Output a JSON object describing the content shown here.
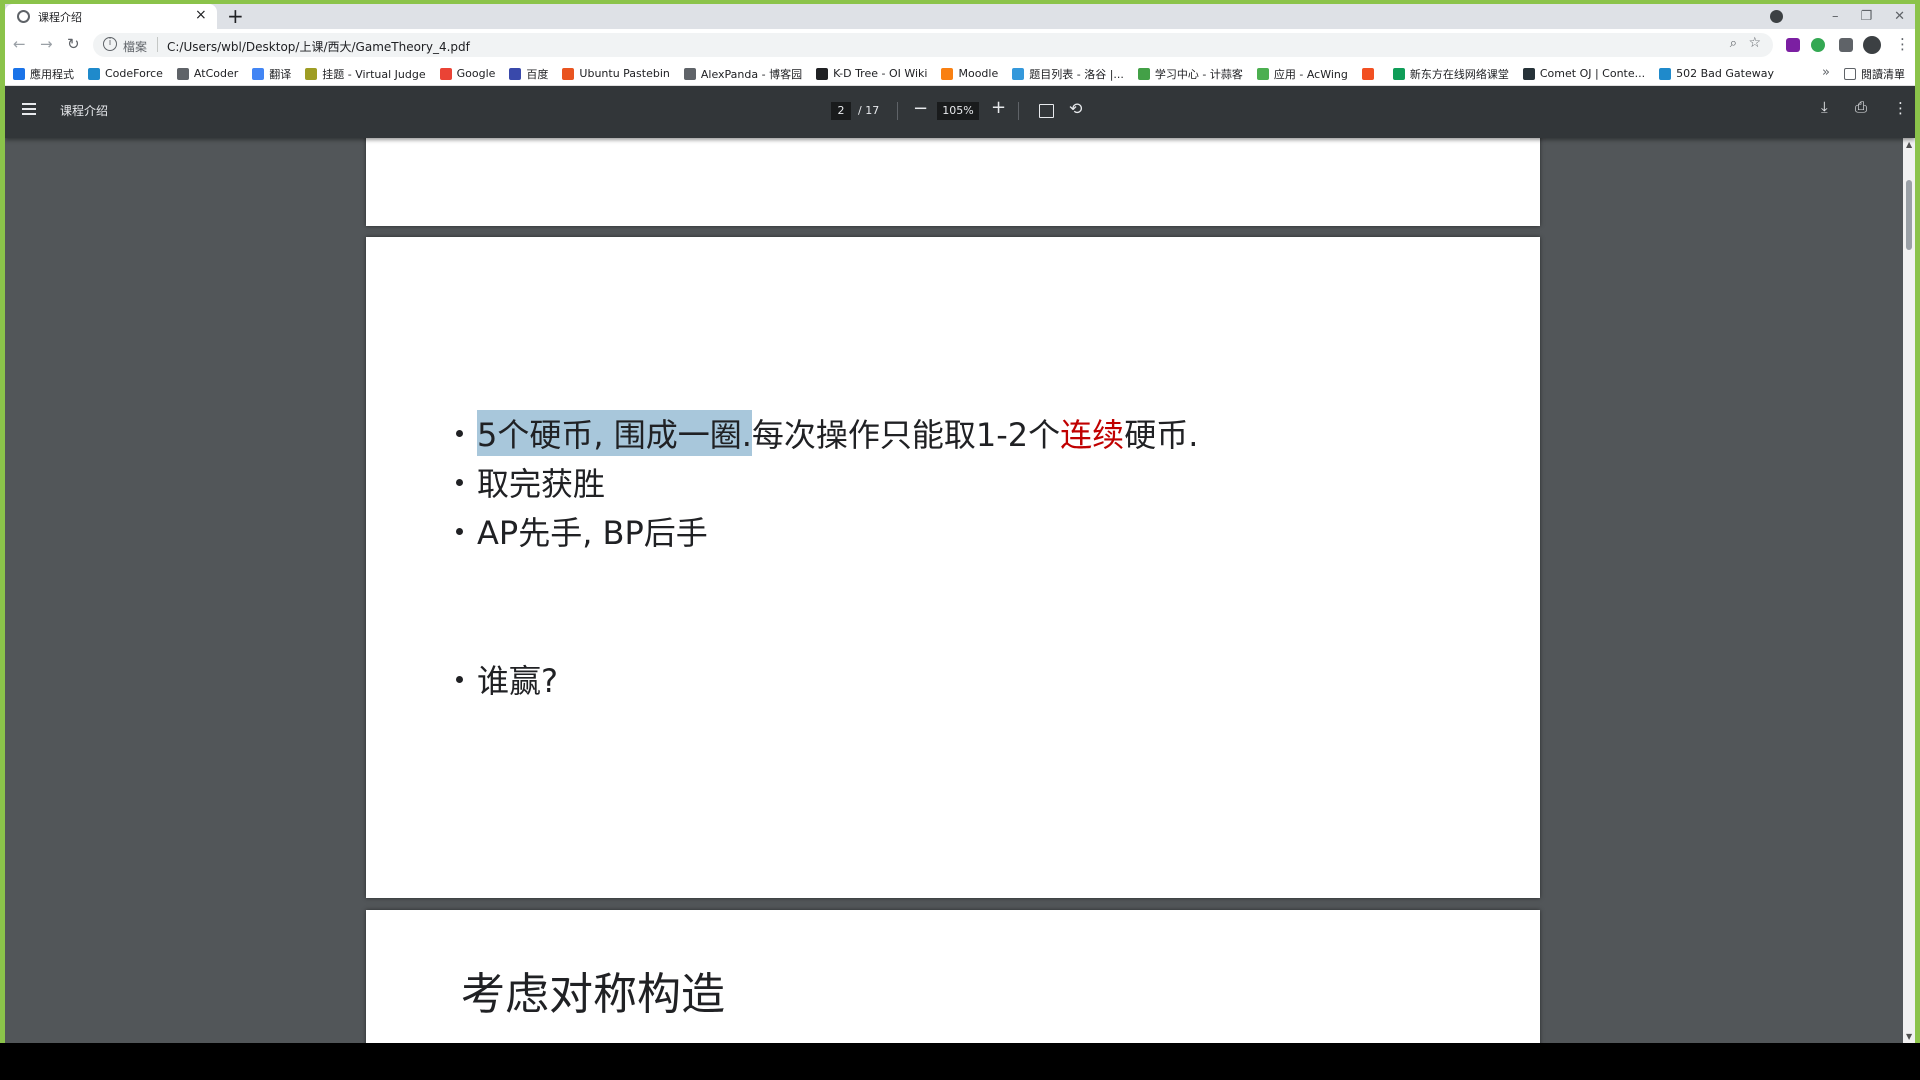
{
  "tab": {
    "title": "课程介绍",
    "close": "×",
    "new_tab": "+"
  },
  "window_controls": {
    "minimize": "–",
    "restore": "❐",
    "close": "✕"
  },
  "address": {
    "scheme": "檔案",
    "url": "C:/Users/wbl/Desktop/上课/西大/GameTheory_4.pdf",
    "info_icon": "i"
  },
  "nav": {
    "back": "←",
    "forward": "→",
    "reload": "↻"
  },
  "bookmarks": [
    {
      "label": "應用程式",
      "color": "#1a73e8"
    },
    {
      "label": "CodeForce",
      "color": "#1f8acb"
    },
    {
      "label": "AtCoder",
      "color": "#5f6368"
    },
    {
      "label": "翻译",
      "color": "#4285f4"
    },
    {
      "label": "挂题 - Virtual Judge",
      "color": "#9e9d24"
    },
    {
      "label": "Google",
      "color": "#ea4335"
    },
    {
      "label": "百度",
      "color": "#3949ab"
    },
    {
      "label": "Ubuntu Pastebin",
      "color": "#e95420"
    },
    {
      "label": "AlexPanda - 博客园",
      "color": "#5f6368"
    },
    {
      "label": "K-D Tree - OI Wiki",
      "color": "#202124"
    },
    {
      "label": "Moodle",
      "color": "#f98012"
    },
    {
      "label": "题目列表 - 洛谷 |...",
      "color": "#3498db"
    },
    {
      "label": "学习中心 - 计蒜客",
      "color": "#43a047"
    },
    {
      "label": "应用 - AcWing",
      "color": "#4caf50"
    },
    {
      "label": "",
      "color": "#f25022"
    },
    {
      "label": "新东方在线网络课堂",
      "color": "#0f9d58"
    },
    {
      "label": "Comet OJ | Conte...",
      "color": "#263238"
    },
    {
      "label": "502 Bad Gateway",
      "color": "#1f8acb"
    }
  ],
  "bookmarks_more": "»",
  "reading_list": "閱讀清單",
  "pdf": {
    "doc_title": "课程介绍",
    "current_page": "2",
    "total_pages": "/ 17",
    "zoom": "105%",
    "zoom_out": "−",
    "zoom_in": "+",
    "rotate": "⟲",
    "download": "⤓",
    "print": "⎙",
    "more": "⋮"
  },
  "slide": {
    "line1": {
      "highlighted": "5个硬币, 围成一圈.",
      "plain": " 每次操作只能取1-2个",
      "red": "连续",
      "tail": "硬币."
    },
    "line2": "取完获胜",
    "line3": "AP先手, BP后手",
    "line4": "谁赢?"
  },
  "next_page_heading": "考虑对称构造",
  "colors": {
    "window_frame": "#8bc34a",
    "pdf_toolbar": "#323639",
    "viewer_bg": "#525659",
    "highlight": "#a8c7db",
    "accent_red": "#c00000"
  }
}
